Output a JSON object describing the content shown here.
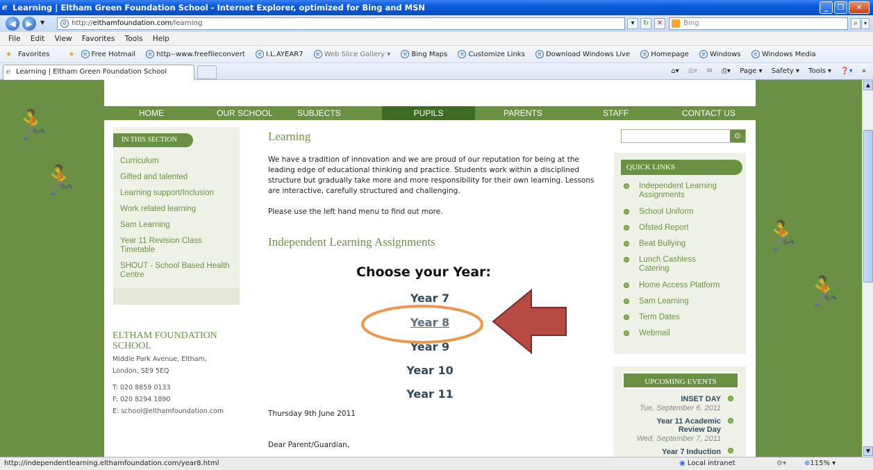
{
  "window": {
    "title": "Learning | Eltham Green Foundation School - Internet Explorer, optimized for Bing and MSN",
    "min": "_",
    "max": "❐",
    "close": "✕"
  },
  "address": {
    "prefix": "http://",
    "domain": "elthamfoundation.com",
    "path": "/learning",
    "search_placeholder": "Bing"
  },
  "menu": [
    "File",
    "Edit",
    "View",
    "Favorites",
    "Tools",
    "Help"
  ],
  "favorites": {
    "label": "Favorites",
    "links": [
      "Free Hotmail",
      "http--www.freefileconvert",
      "I.L.AYEAR7",
      "Web Slice Gallery ▾",
      "Bing Maps",
      "Customize Links",
      "Download Windows Live",
      "Homepage",
      "Windows",
      "Windows Media"
    ]
  },
  "tab": {
    "title": "Learning | Eltham Green Foundation School"
  },
  "commands": [
    "Page ▾",
    "Safety ▾",
    "Tools ▾"
  ],
  "site": {
    "nav": [
      "HOME",
      "OUR SCHOOL",
      "SUBJECTS",
      "PUPILS",
      "PARENTS",
      "STAFF",
      "CONTACT US"
    ],
    "section_header": "IN THIS SECTION",
    "section_items": [
      "Curriculum",
      "Gifted and talented",
      "Learning support/Inclusion",
      "Work related learning",
      "Sam Learning",
      "Year 11 Revision Class Timetable",
      "SHOUT - School Based Health Centre"
    ],
    "school": {
      "name": "ELTHAM FOUNDATION SCHOOL",
      "address1": "Middle Park Avenue, Eltham,",
      "address2": "London, SE9 5EQ",
      "tel": "T: 020 8859 0133",
      "fax": "F: 020 8294 1890",
      "email": "E: school@elthamfoundation.com"
    },
    "main": {
      "title": "Learning",
      "intro": "We have a tradition of innovation and we are proud of our reputation for being at the leading edge of educational thinking and practice. Students work within a disciplined structure but gradually take more and more responsibility for their own learning. Lessons are interactive, carefully structured and challenging.",
      "more": "Please use the left hand menu to find out more.",
      "ila_heading": "Independent Learning Assignments",
      "choose": "Choose your Year:",
      "years": [
        "Year 7",
        "Year 8",
        "Year 9",
        "Year 10",
        "Year 11"
      ],
      "date": "Thursday 9th June 2011",
      "greeting": "Dear Parent/Guardian,"
    },
    "quick_links_header": "QUICK LINKS",
    "quick_links": [
      "Independent Learning Assignments",
      "School Uniform",
      "Ofsted Report",
      "Beat Bullying",
      "Lunch Cashless Catering",
      "Home Access Platform",
      "Sam Learning",
      "Term Dates",
      "Webmail"
    ],
    "events_header": "UPCOMING EVENTS",
    "events": [
      {
        "title": "INSET DAY",
        "date": "Tue, September 6, 2011"
      },
      {
        "title": "Year 11 Academic Review Day",
        "date": "Wed, September 7, 2011"
      },
      {
        "title": "Year 7 Induction",
        "date": ""
      }
    ]
  },
  "status": {
    "url": "http://independentlearning.elthamfoundation.com/year8.html",
    "zone": "Local intranet",
    "zoom": "115%"
  },
  "colors": {
    "site_green": "#6a9143",
    "annotation_arrow": "#b84a44",
    "annotation_ellipse": "#f0954a"
  }
}
